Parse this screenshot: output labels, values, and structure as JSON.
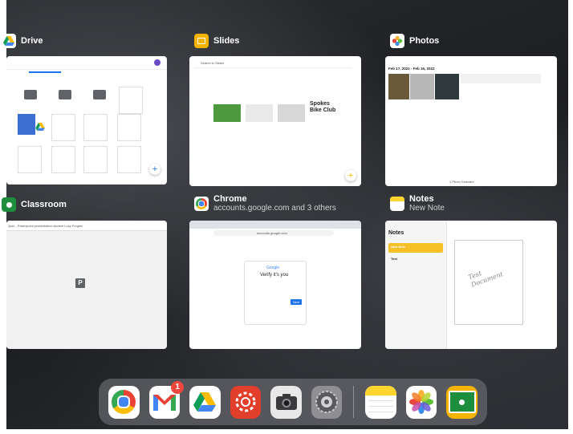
{
  "cards": {
    "drive": {
      "title": "Drive",
      "subtitle": ""
    },
    "slides": {
      "title": "Slides",
      "subtitle": "",
      "thumb": {
        "search": "Search in Slides",
        "heading": "Spokes Bike Club"
      }
    },
    "photos": {
      "title": "Photos",
      "subtitle": "",
      "thumb": {
        "date_range": "Feb 17, 2021 - Feb 16, 2022",
        "footer": "1 Photo Selected"
      }
    },
    "classroom": {
      "title": "Classroom",
      "subtitle": "",
      "thumb": {
        "header": "Quiz - Powerpoint presentation student Lucy Furgeis",
        "file_letter": "P"
      }
    },
    "chrome": {
      "title": "Chrome",
      "subtitle": "accounts.google.com and 3 others",
      "thumb": {
        "address": "accounts.google.com",
        "google_label": "Google",
        "heading": "Verify it's you",
        "next_label": "Next"
      }
    },
    "notes": {
      "title": "Notes",
      "subtitle": "New Note",
      "thumb": {
        "sidebar_title": "Notes",
        "note1": "New Note",
        "note2": "Test",
        "handwriting": "Test Document"
      }
    }
  },
  "dock": {
    "apps": [
      {
        "name": "Chrome",
        "icon": "chrome-icon"
      },
      {
        "name": "Gmail",
        "icon": "gmail-icon",
        "badge": "1"
      },
      {
        "name": "Drive",
        "icon": "drive-icon"
      },
      {
        "name": "Canvas",
        "icon": "canvas-icon"
      },
      {
        "name": "Camera",
        "icon": "camera-icon"
      },
      {
        "name": "Settings",
        "icon": "settings-icon"
      },
      {
        "name": "Notes",
        "icon": "notes-icon"
      },
      {
        "name": "Photos",
        "icon": "photos-icon"
      },
      {
        "name": "Classroom",
        "icon": "classroom-icon"
      }
    ]
  },
  "colors": {
    "google_blue": "#1a73e8",
    "slides_yellow": "#f4b400",
    "notes_yellow": "#ffd52e",
    "gmail_red": "#ea4335"
  }
}
